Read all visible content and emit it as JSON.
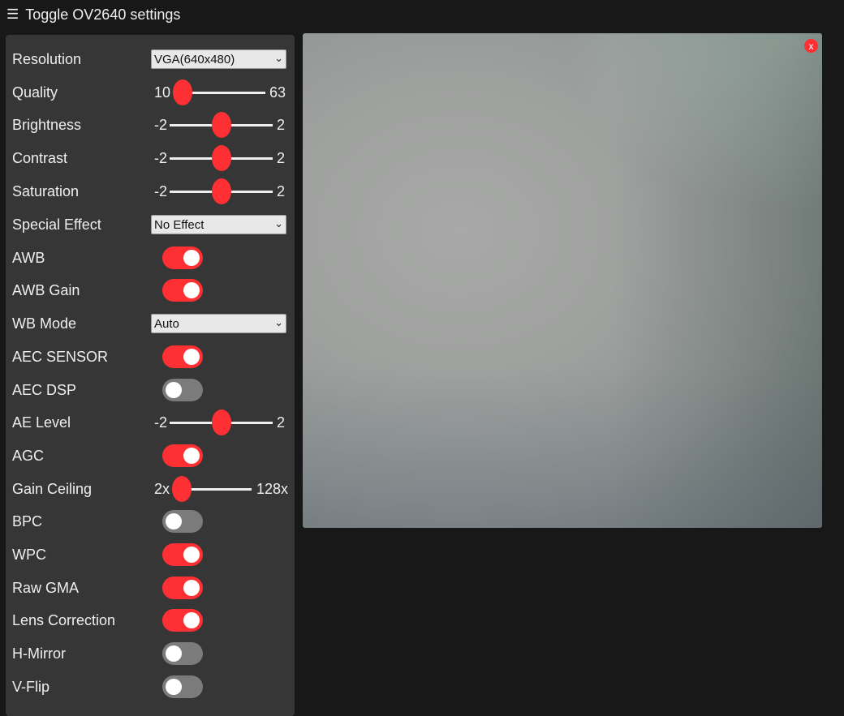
{
  "header": {
    "menu_icon": "☰",
    "title": "Toggle OV2640 settings"
  },
  "settings": {
    "resolution": {
      "label": "Resolution",
      "value": "VGA(640x480)"
    },
    "quality": {
      "label": "Quality",
      "min": "10",
      "max": "63",
      "value": 10
    },
    "brightness": {
      "label": "Brightness",
      "min": "-2",
      "max": "2",
      "value": 0
    },
    "contrast": {
      "label": "Contrast",
      "min": "-2",
      "max": "2",
      "value": 0
    },
    "saturation": {
      "label": "Saturation",
      "min": "-2",
      "max": "2",
      "value": 0
    },
    "special_effect": {
      "label": "Special Effect",
      "value": "No Effect"
    },
    "awb": {
      "label": "AWB",
      "on": true
    },
    "awb_gain": {
      "label": "AWB Gain",
      "on": true
    },
    "wb_mode": {
      "label": "WB Mode",
      "value": "Auto"
    },
    "aec_sensor": {
      "label": "AEC SENSOR",
      "on": true
    },
    "aec_dsp": {
      "label": "AEC DSP",
      "on": false
    },
    "ae_level": {
      "label": "AE Level",
      "min": "-2",
      "max": "2",
      "value": 0
    },
    "agc": {
      "label": "AGC",
      "on": true
    },
    "gain_ceiling": {
      "label": "Gain Ceiling",
      "min": "2x",
      "max": "128x",
      "value": 0
    },
    "bpc": {
      "label": "BPC",
      "on": false
    },
    "wpc": {
      "label": "WPC",
      "on": true
    },
    "raw_gma": {
      "label": "Raw GMA",
      "on": true
    },
    "lens_correction": {
      "label": "Lens Correction",
      "on": true
    },
    "h_mirror": {
      "label": "H-Mirror",
      "on": false
    },
    "v_flip": {
      "label": "V-Flip",
      "on": false
    }
  },
  "stream": {
    "close_label": "x"
  },
  "colors": {
    "accent": "#ff3034",
    "panel": "#363636",
    "background": "#181818"
  },
  "icons": {
    "menu": "menu-icon",
    "chevron": "chevron-down-icon",
    "close": "close-icon"
  }
}
